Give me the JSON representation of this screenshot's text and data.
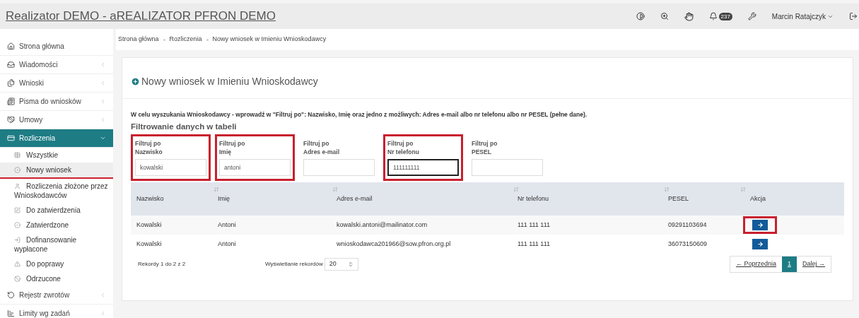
{
  "app_title": "Realizator DEMO - aREALIZATOR PFRON DEMO",
  "header": {
    "notifications_count": "237",
    "user_name": "Marcin Ratajczyk"
  },
  "sidebar": {
    "items": [
      {
        "label": "Strona główna",
        "has_submenu": false,
        "selected": false
      },
      {
        "label": "Wiadomości",
        "has_submenu": true,
        "selected": false,
        "expanded": false
      },
      {
        "label": "Wnioski",
        "has_submenu": true,
        "selected": false,
        "expanded": false
      },
      {
        "label": "Pisma do wniosków",
        "has_submenu": true,
        "selected": false,
        "expanded": false
      },
      {
        "label": "Umowy",
        "has_submenu": true,
        "selected": false,
        "expanded": false
      },
      {
        "label": "Rozliczenia",
        "has_submenu": true,
        "selected": true,
        "expanded": true,
        "children": [
          {
            "label": "Wszystkie",
            "selected": false,
            "highlighted": false
          },
          {
            "label": "Nowy wniosek",
            "selected": true,
            "highlighted": true
          },
          {
            "label": "Rozliczenia złożone przez Wnioskodawców",
            "selected": false,
            "highlighted": false
          },
          {
            "label": "Do zatwierdzenia",
            "selected": false,
            "highlighted": false
          },
          {
            "label": "Zatwierdzone",
            "selected": false,
            "highlighted": false
          },
          {
            "label": "Dofinansowanie wypłacone",
            "selected": false,
            "highlighted": false
          },
          {
            "label": "Do poprawy",
            "selected": false,
            "highlighted": false
          },
          {
            "label": "Odrzucone",
            "selected": false,
            "highlighted": false
          }
        ]
      },
      {
        "label": "Rejestr zwrotów",
        "has_submenu": true,
        "selected": false,
        "expanded": false
      },
      {
        "label": "Limity wg zadań",
        "has_submenu": true,
        "selected": false,
        "expanded": false
      }
    ]
  },
  "breadcrumb": [
    "Strona główna",
    "Rozliczenia",
    "Nowy wniosek w Imieniu Wnioskodawcy"
  ],
  "page_title": "Nowy wniosek w Imieniu Wnioskodawcy",
  "instruction": "W celu wyszukania Wnioskodawcy - wprowadź w \"Filtruj po\": Nazwisko, Imię oraz jedno z możliwych: Adres e-mail albo nr telefonu albo nr PESEL (pełne dane).",
  "filter_heading": "Filtrowanie danych w tabeli",
  "filters": [
    {
      "label_1": "Filtruj po",
      "label_2": "Nazwisko",
      "value": "kowalski",
      "highlighted": true,
      "focused": false
    },
    {
      "label_1": "Filtruj po",
      "label_2": "Imię",
      "value": "antoni",
      "highlighted": true,
      "focused": false
    },
    {
      "label_1": "Filtruj po",
      "label_2": "Adres e-mail",
      "highlighted": false,
      "focused": false
    },
    {
      "label_1": "Filtruj po",
      "label_2": "Nr telefonu",
      "value": "111111111",
      "highlighted": true,
      "focused": true
    },
    {
      "label_1": "Filtruj po",
      "label_2": "PESEL",
      "highlighted": false,
      "focused": false
    }
  ],
  "table": {
    "columns": [
      {
        "label": "Nazwisko",
        "sortable": false
      },
      {
        "label": "Imię",
        "sortable": true
      },
      {
        "label": "Adres e-mail",
        "sortable": true
      },
      {
        "label": "Nr telefonu",
        "sortable": true
      },
      {
        "label": "PESEL",
        "sortable": true
      },
      {
        "label": "Akcja",
        "sortable": true
      }
    ],
    "rows": [
      {
        "cells": [
          "Kowalski",
          "Antoni",
          "kowalski.antoni@mailinator.com",
          "111 111 111",
          "09291103694"
        ],
        "action_highlighted": true
      },
      {
        "cells": [
          "Kowalski",
          "Antoni",
          "wnioskodawca201966@sow.pfron.org.pl",
          "111 111 111",
          "36073150609"
        ],
        "action_highlighted": false
      }
    ]
  },
  "records_info": "Rekordy 1 do 2 z 2",
  "page_size_label": "Wyświetlanie rekordów",
  "page_size": "20",
  "pagination": {
    "prev": "← Poprzednia",
    "pages": [
      {
        "label": "1",
        "selected": true
      }
    ],
    "next": "Dalej →"
  }
}
